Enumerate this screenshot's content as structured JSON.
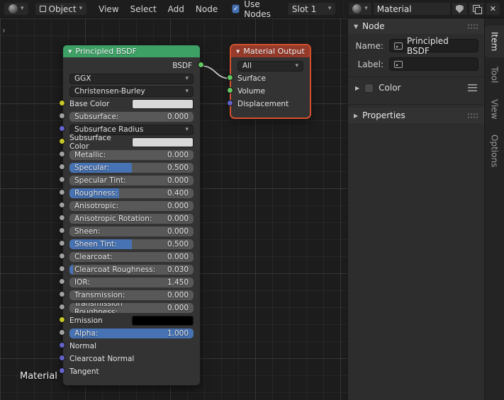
{
  "icons": {
    "chevron_down": "▾",
    "check": "✓",
    "close": "✕",
    "tri_down": "▼",
    "tri_right": "▶",
    "collapse_arrow": "›"
  },
  "colors": {
    "accent_blue": "#4772b3",
    "principled_header": "#3da065",
    "output_header": "#963a2a",
    "selected_outline": "#d4502e",
    "noodle": "#d8d8d8",
    "socket_colors": {
      "color": "#c7c729",
      "value": "#a1a1a1",
      "vector": "#6363c7",
      "shader": "#63c763"
    }
  },
  "header": {
    "mode": {
      "label": "Object"
    },
    "menus": [
      "View",
      "Select",
      "Add",
      "Node"
    ],
    "use_nodes": {
      "label": "Use Nodes",
      "checked": true
    },
    "slot": {
      "label": "Slot 1"
    },
    "material": {
      "name": "Material"
    }
  },
  "editor": {
    "breadcrumb": "Material"
  },
  "nodes": {
    "principled": {
      "title": "Principled BSDF",
      "output_label": "BSDF",
      "rows": [
        {
          "kind": "dropdown",
          "label": "GGX",
          "socket": null
        },
        {
          "kind": "dropdown",
          "label": "Christensen-Burley",
          "socket": null
        },
        {
          "kind": "color",
          "label": "Base Color",
          "swatch": "#d9d9d9",
          "socket": "color"
        },
        {
          "kind": "slider",
          "label": "Subsurface:",
          "value": "0.000",
          "fill": 0,
          "socket": "value"
        },
        {
          "kind": "dropdown",
          "label": "Subsurface Radius",
          "socket": "vector"
        },
        {
          "kind": "color",
          "label": "Subsurface Color",
          "swatch": "#d9d9d9",
          "socket": "color"
        },
        {
          "kind": "slider",
          "label": "Metallic:",
          "value": "0.000",
          "fill": 0,
          "socket": "value"
        },
        {
          "kind": "slider",
          "label": "Specular:",
          "value": "0.500",
          "fill": 0.5,
          "socket": "value"
        },
        {
          "kind": "slider",
          "label": "Specular Tint:",
          "value": "0.000",
          "fill": 0,
          "socket": "value"
        },
        {
          "kind": "slider",
          "label": "Roughness:",
          "value": "0.400",
          "fill": 0.4,
          "socket": "value"
        },
        {
          "kind": "slider",
          "label": "Anisotropic:",
          "value": "0.000",
          "fill": 0,
          "socket": "value"
        },
        {
          "kind": "slider",
          "label": "Anisotropic Rotation:",
          "value": "0.000",
          "fill": 0,
          "socket": "value"
        },
        {
          "kind": "slider",
          "label": "Sheen:",
          "value": "0.000",
          "fill": 0,
          "socket": "value"
        },
        {
          "kind": "slider",
          "label": "Sheen Tint:",
          "value": "0.500",
          "fill": 0.5,
          "socket": "value"
        },
        {
          "kind": "slider",
          "label": "Clearcoat:",
          "value": "0.000",
          "fill": 0,
          "socket": "value"
        },
        {
          "kind": "slider",
          "label": "Clearcoat Roughness:",
          "value": "0.030",
          "fill": 0.03,
          "socket": "value"
        },
        {
          "kind": "slider",
          "label": "IOR:",
          "value": "1.450",
          "fill": 0,
          "socket": "value"
        },
        {
          "kind": "slider",
          "label": "Transmission:",
          "value": "0.000",
          "fill": 0,
          "socket": "value"
        },
        {
          "kind": "slider",
          "label": "Transmission Roughness:",
          "value": "0.000",
          "fill": 0,
          "socket": "value"
        },
        {
          "kind": "color",
          "label": "Emission",
          "swatch": "#000000",
          "socket": "color"
        },
        {
          "kind": "slider",
          "label": "Alpha:",
          "value": "1.000",
          "fill": 1,
          "socket": "value"
        },
        {
          "kind": "plain",
          "label": "Normal",
          "socket": "vector"
        },
        {
          "kind": "plain",
          "label": "Clearcoat Normal",
          "socket": "vector"
        },
        {
          "kind": "plain",
          "label": "Tangent",
          "socket": "vector"
        }
      ]
    },
    "material_output": {
      "title": "Material Output",
      "dropdown": "All",
      "inputs": [
        {
          "label": "Surface",
          "socket": "shader",
          "connected": true
        },
        {
          "label": "Volume",
          "socket": "shader",
          "connected": false
        },
        {
          "label": "Displacement",
          "socket": "vector",
          "connected": false
        }
      ]
    }
  },
  "sidebar": {
    "node_panel": {
      "title": "Node",
      "name_label": "Name:",
      "name_value": "Principled BSDF",
      "label_label": "Label:",
      "label_value": "",
      "color_label": "Color"
    },
    "properties_panel": {
      "title": "Properties"
    },
    "tabs": [
      "Item",
      "Tool",
      "View",
      "Options"
    ],
    "active_tab": 0
  }
}
